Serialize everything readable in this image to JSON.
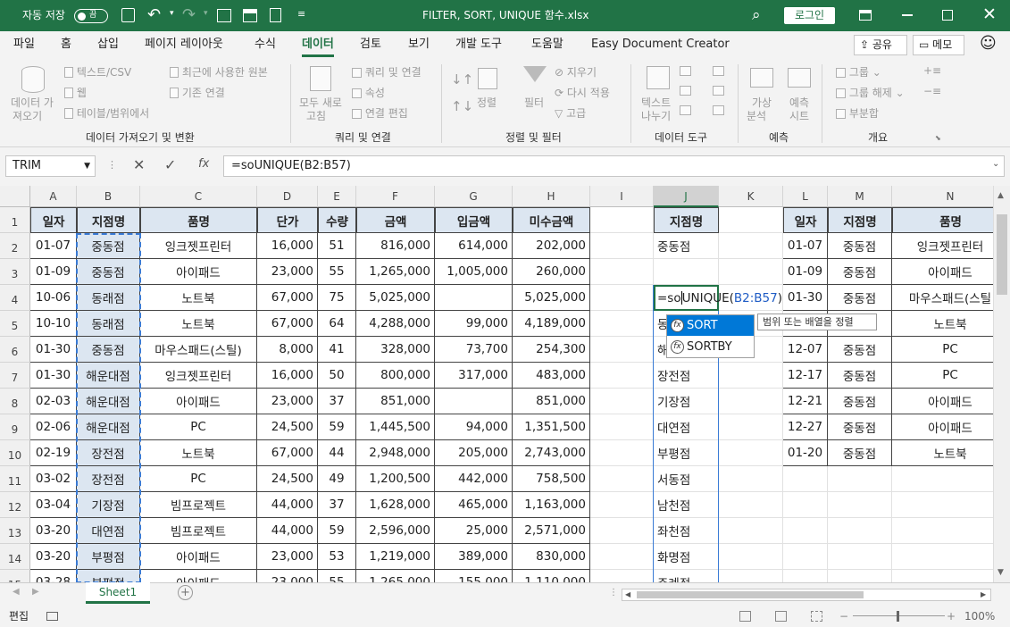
{
  "titlebar": {
    "autosave_label": "자동 저장",
    "autosave_state": "끔",
    "filename": "FILTER, SORT, UNIQUE 함수.xlsx",
    "login_label": "로그인"
  },
  "menu": [
    "파일",
    "홈",
    "삽입",
    "페이지 레이아웃",
    "수식",
    "데이터",
    "검토",
    "보기",
    "개발 도구",
    "도움말",
    "Easy Document Creator"
  ],
  "share_label": "공유",
  "memo_label": "메모",
  "ribbon": {
    "get_data": {
      "label1": "데이터 가",
      "label2": "져오기",
      "items": [
        "텍스트/CSV",
        "웹",
        "테이블/범위에서"
      ],
      "items2": [
        "최근에 사용한 원본",
        "기존 연결"
      ],
      "group": "데이터 가져오기 및 변환"
    },
    "queries": {
      "label1": "모두 새로",
      "label2": "고침",
      "items": [
        "쿼리 및 연결",
        "속성",
        "연결 편집"
      ],
      "group": "쿼리 및 연결"
    },
    "sort": {
      "sort_label": "정렬",
      "filter_label": "필터",
      "items": [
        "지우기",
        "다시 적용",
        "고급"
      ],
      "group": "정렬 및 필터"
    },
    "tools": {
      "label1": "텍스트",
      "label2": "나누기",
      "group": "데이터 도구"
    },
    "forecast": {
      "whatif1": "가상",
      "whatif2": "분석",
      "sheet1": "예측",
      "sheet2": "시트",
      "group": "예측"
    },
    "outline": {
      "items": [
        "그룹",
        "그룹 해제",
        "부분합"
      ],
      "group": "개요"
    }
  },
  "namebox": "TRIM",
  "formula": "=soUNIQUE(B2:B57)",
  "columns": [
    "A",
    "B",
    "C",
    "D",
    "E",
    "F",
    "G",
    "H",
    "I",
    "J",
    "K",
    "L",
    "M",
    "N"
  ],
  "rows": [
    "1",
    "2",
    "3",
    "4",
    "5",
    "6",
    "7",
    "8",
    "9",
    "10",
    "11",
    "12",
    "13",
    "14",
    "15"
  ],
  "headers": [
    "일자",
    "지점명",
    "품명",
    "단가",
    "수량",
    "금액",
    "입금액",
    "미수금액"
  ],
  "table": [
    [
      "01-07",
      "중동점",
      "잉크젯프린터",
      "16,000",
      "51",
      "816,000",
      "614,000",
      "202,000"
    ],
    [
      "01-09",
      "중동점",
      "아이패드",
      "23,000",
      "55",
      "1,265,000",
      "1,005,000",
      "260,000"
    ],
    [
      "10-06",
      "동래점",
      "노트북",
      "67,000",
      "75",
      "5,025,000",
      "",
      "5,025,000"
    ],
    [
      "10-10",
      "동래점",
      "노트북",
      "67,000",
      "64",
      "4,288,000",
      "99,000",
      "4,189,000"
    ],
    [
      "01-30",
      "중동점",
      "마우스패드(스틸)",
      "8,000",
      "41",
      "328,000",
      "73,700",
      "254,300"
    ],
    [
      "01-30",
      "해운대점",
      "잉크젯프린터",
      "16,000",
      "50",
      "800,000",
      "317,000",
      "483,000"
    ],
    [
      "02-03",
      "해운대점",
      "아이패드",
      "23,000",
      "37",
      "851,000",
      "",
      "851,000"
    ],
    [
      "02-06",
      "해운대점",
      "PC",
      "24,500",
      "59",
      "1,445,500",
      "94,000",
      "1,351,500"
    ],
    [
      "02-19",
      "장전점",
      "노트북",
      "67,000",
      "44",
      "2,948,000",
      "205,000",
      "2,743,000"
    ],
    [
      "03-02",
      "장전점",
      "PC",
      "24,500",
      "49",
      "1,200,500",
      "442,000",
      "758,500"
    ],
    [
      "03-04",
      "기장점",
      "빔프로젝트",
      "44,000",
      "37",
      "1,628,000",
      "465,000",
      "1,163,000"
    ],
    [
      "03-20",
      "대연점",
      "빔프로젝트",
      "44,000",
      "59",
      "2,596,000",
      "25,000",
      "2,571,000"
    ],
    [
      "03-20",
      "부평점",
      "아이패드",
      "23,000",
      "53",
      "1,219,000",
      "389,000",
      "830,000"
    ],
    [
      "03-28",
      "부평점",
      "아이패드",
      "23,000",
      "55",
      "1,265,000",
      "155,000",
      "1,110,000"
    ]
  ],
  "j_header": "지점명",
  "j_values": [
    "중동점",
    "",
    "",
    "동",
    "해",
    "장전점",
    "기장점",
    "대연점",
    "부평점",
    "서동점",
    "남천점",
    "좌천점",
    "화명점",
    "주례점"
  ],
  "j4_prefix": "=so",
  "j4_func": "UNIQUE(",
  "j4_ref": "B2:B57",
  "j4_suffix": ")",
  "lmn_headers": [
    "일자",
    "지점명",
    "품명"
  ],
  "lmn": [
    [
      "01-07",
      "중동점",
      "잉크젯프린터"
    ],
    [
      "01-09",
      "중동점",
      "아이패드"
    ],
    [
      "01-30",
      "중동점",
      "마우스패드(스틸"
    ],
    [
      "",
      "",
      "노트북"
    ],
    [
      "12-07",
      "중동점",
      "PC"
    ],
    [
      "12-17",
      "중동점",
      "PC"
    ],
    [
      "12-21",
      "중동점",
      "아이패드"
    ],
    [
      "12-27",
      "중동점",
      "아이패드"
    ],
    [
      "01-20",
      "중동점",
      "노트북"
    ]
  ],
  "autocomplete": [
    "SORT",
    "SORTBY"
  ],
  "tooltip": "범위 또는 배열을 정렬",
  "sheet_tab": "Sheet1",
  "status": {
    "mode": "편집",
    "zoom": "100%"
  }
}
